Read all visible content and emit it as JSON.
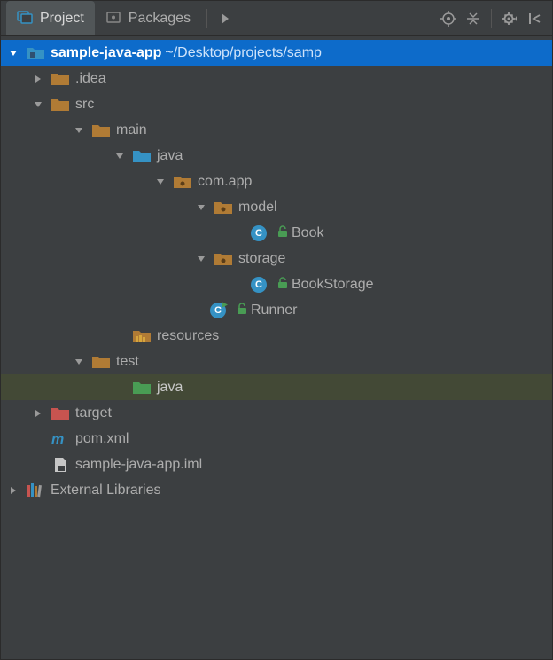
{
  "toolbar": {
    "tabs": [
      {
        "label": "Project",
        "active": true
      },
      {
        "label": "Packages",
        "active": false
      }
    ]
  },
  "tree": {
    "root": {
      "name": "sample-java-app",
      "path": "~/Desktop/projects/samp"
    },
    "idea": ".idea",
    "src": "src",
    "main": "main",
    "java_main": "java",
    "comapp": "com.app",
    "model": "model",
    "book": "Book",
    "storage": "storage",
    "bookstorage": "BookStorage",
    "runner": "Runner",
    "resources": "resources",
    "test": "test",
    "java_test": "java",
    "target": "target",
    "pom": "pom.xml",
    "iml": "sample-java-app.iml",
    "ext": "External Libraries"
  }
}
